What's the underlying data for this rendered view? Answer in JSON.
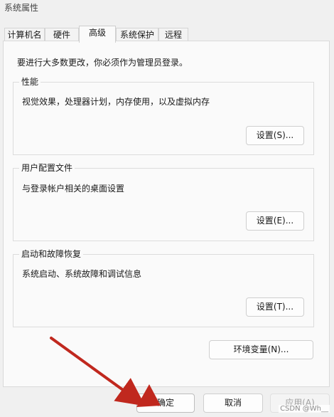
{
  "window": {
    "title": "系统属性"
  },
  "tabs": [
    {
      "label": "计算机名",
      "active": false
    },
    {
      "label": "硬件",
      "active": false
    },
    {
      "label": "高级",
      "active": true
    },
    {
      "label": "系统保护",
      "active": false
    },
    {
      "label": "远程",
      "active": false
    }
  ],
  "advanced": {
    "admin_note": "要进行大多数更改，你必须作为管理员登录。",
    "performance": {
      "legend": "性能",
      "description": "视觉效果，处理器计划，内存使用，以及虚拟内存",
      "button": "设置(S)..."
    },
    "user_profiles": {
      "legend": "用户配置文件",
      "description": "与登录帐户相关的桌面设置",
      "button": "设置(E)..."
    },
    "startup_recovery": {
      "legend": "启动和故障恢复",
      "description": "系统启动、系统故障和调试信息",
      "button": "设置(T)..."
    },
    "env_button": "环境变量(N)..."
  },
  "footer": {
    "ok": "确定",
    "cancel": "取消",
    "apply": "应用(A)"
  },
  "watermark": "CSDN @Wh__",
  "annotation": {
    "arrow_color": "#c0281e"
  }
}
